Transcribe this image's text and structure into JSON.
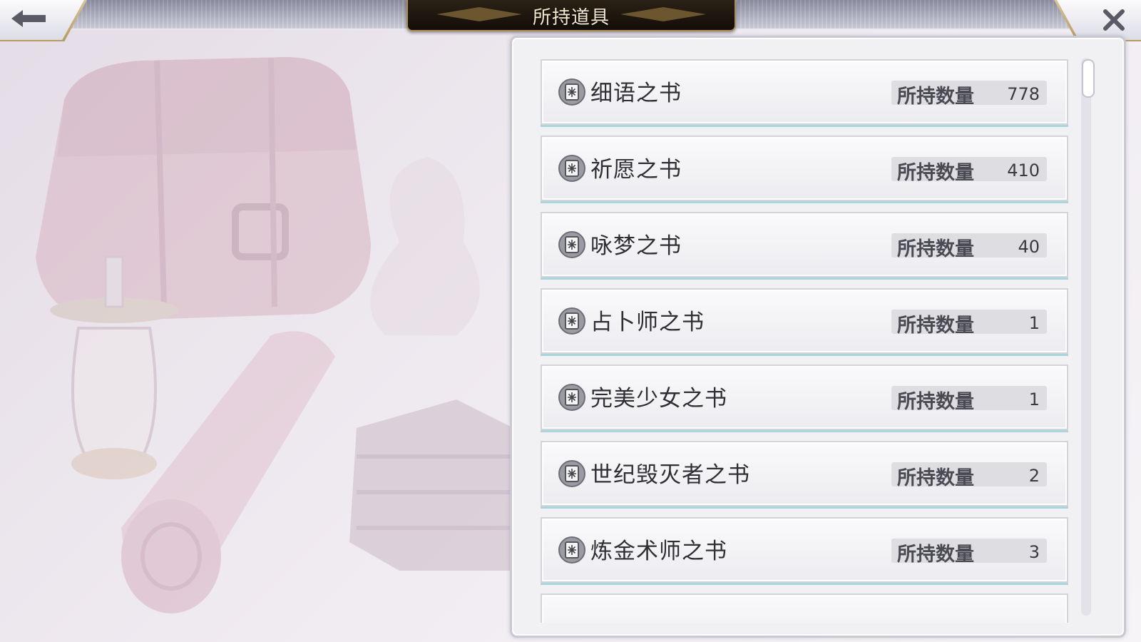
{
  "header": {
    "title": "所持道具",
    "back_icon": "left-arrow-icon",
    "close_icon": "close-x-icon"
  },
  "colors": {
    "title_plate": "#1a140c",
    "title_border": "#a98f5c",
    "item_accent": "#a8d6dc",
    "panel_bg": "#f1f1f4"
  },
  "items": [
    {
      "name": "细语之书",
      "qty_label": "所持数量",
      "qty": "778",
      "icon": "book-icon"
    },
    {
      "name": "祈愿之书",
      "qty_label": "所持数量",
      "qty": "410",
      "icon": "book-icon"
    },
    {
      "name": "咏梦之书",
      "qty_label": "所持数量",
      "qty": "40",
      "icon": "book-icon"
    },
    {
      "name": "占卜师之书",
      "qty_label": "所持数量",
      "qty": "1",
      "icon": "book-icon"
    },
    {
      "name": "完美少女之书",
      "qty_label": "所持数量",
      "qty": "1",
      "icon": "book-icon"
    },
    {
      "name": "世纪毁灭者之书",
      "qty_label": "所持数量",
      "qty": "2",
      "icon": "book-icon"
    },
    {
      "name": "炼金术师之书",
      "qty_label": "所持数量",
      "qty": "3",
      "icon": "book-icon"
    }
  ],
  "scroll": {
    "position": 0.0
  }
}
